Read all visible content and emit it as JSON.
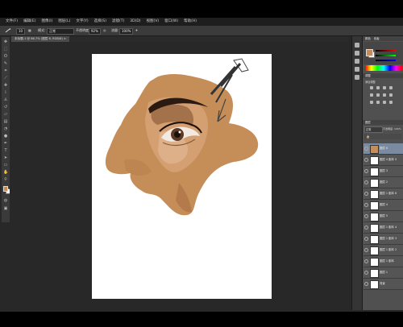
{
  "menu": [
    "文件(F)",
    "编辑(E)",
    "图像(I)",
    "图层(L)",
    "文字(Y)",
    "选择(S)",
    "滤镜(T)",
    "3D(D)",
    "视图(V)",
    "窗口(W)",
    "帮助(H)"
  ],
  "options": {
    "brush_size": "10",
    "mode_label": "模式:",
    "mode_value": "正常",
    "opacity_label": "不透明度:",
    "opacity_value": "92%",
    "flow_label": "流量:",
    "flow_value": "100%"
  },
  "document_tab": "未标题-1 @ 66.7% (图层 6, RGB/8) ×",
  "colors": {
    "foreground": "#c98b55",
    "background": "#ffffff",
    "canvas_bg": "#282828",
    "panel_bg": "#505050"
  },
  "panels": {
    "color_tab": "颜色",
    "swatches_tab": "色板",
    "adjustments_tab": "调整",
    "adjustments_hint": "添加调整",
    "layers_tab": "图层",
    "blend_mode": "正常",
    "opacity_label": "不透明度: 100%",
    "layers": [
      {
        "name": "图层 6",
        "selected": true,
        "thumb": "portrait"
      },
      {
        "name": "图层 4 副本 5",
        "selected": false
      },
      {
        "name": "图层 3",
        "selected": false
      },
      {
        "name": "图层 2",
        "selected": false
      },
      {
        "name": "图层 1 副本 6",
        "selected": false
      },
      {
        "name": "图层 4",
        "selected": false
      },
      {
        "name": "图层 5",
        "selected": false
      },
      {
        "name": "图层 1 副本 4",
        "selected": false
      },
      {
        "name": "图层 1 副本 3",
        "selected": false
      },
      {
        "name": "图层 1 副本 2",
        "selected": false
      },
      {
        "name": "图层 1 副本",
        "selected": false
      },
      {
        "name": "图层 1",
        "selected": false
      },
      {
        "name": "背景",
        "selected": false
      }
    ]
  },
  "tools": [
    "move-icon",
    "marquee-icon",
    "lasso-icon",
    "quick-select-icon",
    "crop-icon",
    "eyedropper-icon",
    "healing-icon",
    "brush-icon",
    "clone-stamp-icon",
    "history-brush-icon",
    "eraser-icon",
    "gradient-icon",
    "blur-icon",
    "dodge-icon",
    "pen-icon",
    "type-icon",
    "path-select-icon",
    "shape-icon",
    "hand-icon",
    "zoom-icon"
  ]
}
